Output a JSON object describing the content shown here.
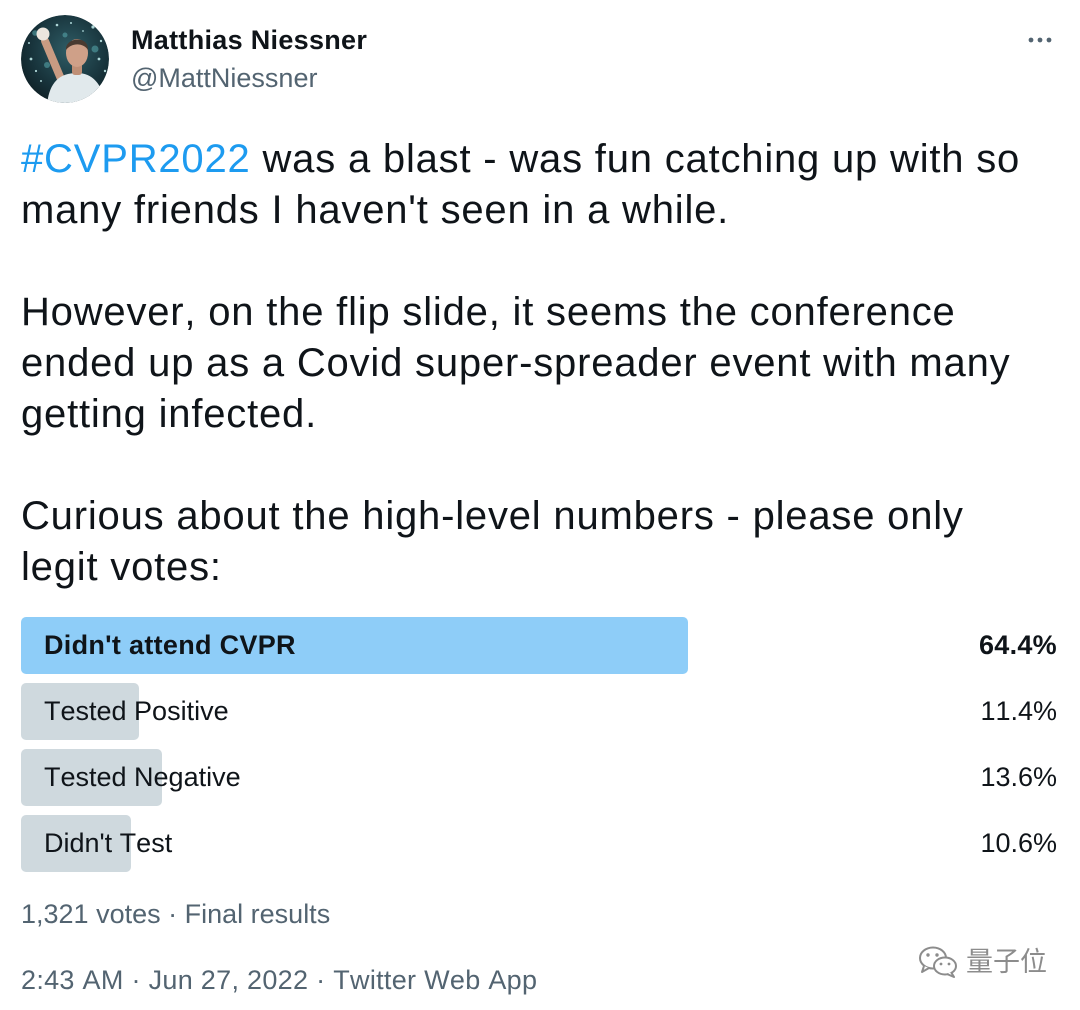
{
  "colors": {
    "text": "#0f1419",
    "secondary": "#536471",
    "link": "#1d9bf0",
    "poll_winner": "#8ecdf8",
    "poll_bar": "#cfd9de",
    "watermark": "#8c8c8c"
  },
  "icons": {
    "more": "more-horizontal-icon",
    "watermark": "wechat-icon"
  },
  "author": {
    "name": "Matthias Niessner",
    "handle": "@MattNiessner"
  },
  "tweet": {
    "paragraphs": [
      {
        "hashtag": "#CVPR2022",
        "text": "was a blast - was fun catching up with so many friends I haven't seen in a while."
      },
      {
        "text": "However, on the flip slide, it seems the conference ended up as a Covid super-spreader event with many getting infected."
      },
      {
        "text": "Curious about the high-level numbers - please only legit votes:"
      }
    ]
  },
  "poll": {
    "options": [
      {
        "label": "Didn't attend CVPR",
        "percent": 64.4,
        "percent_label": "64.4%",
        "winner": true
      },
      {
        "label": "Tested Positive",
        "percent": 11.4,
        "percent_label": "11.4%",
        "winner": false
      },
      {
        "label": "Tested Negative",
        "percent": 13.6,
        "percent_label": "13.6%",
        "winner": false
      },
      {
        "label": "Didn't Test",
        "percent": 10.6,
        "percent_label": "10.6%",
        "winner": false
      }
    ],
    "votes": "1,321 votes",
    "status": "Final results"
  },
  "separator": "·",
  "meta": {
    "time": "2:43 AM",
    "date": "Jun 27, 2022",
    "source": "Twitter Web App"
  },
  "watermark": {
    "text": "量子位"
  }
}
